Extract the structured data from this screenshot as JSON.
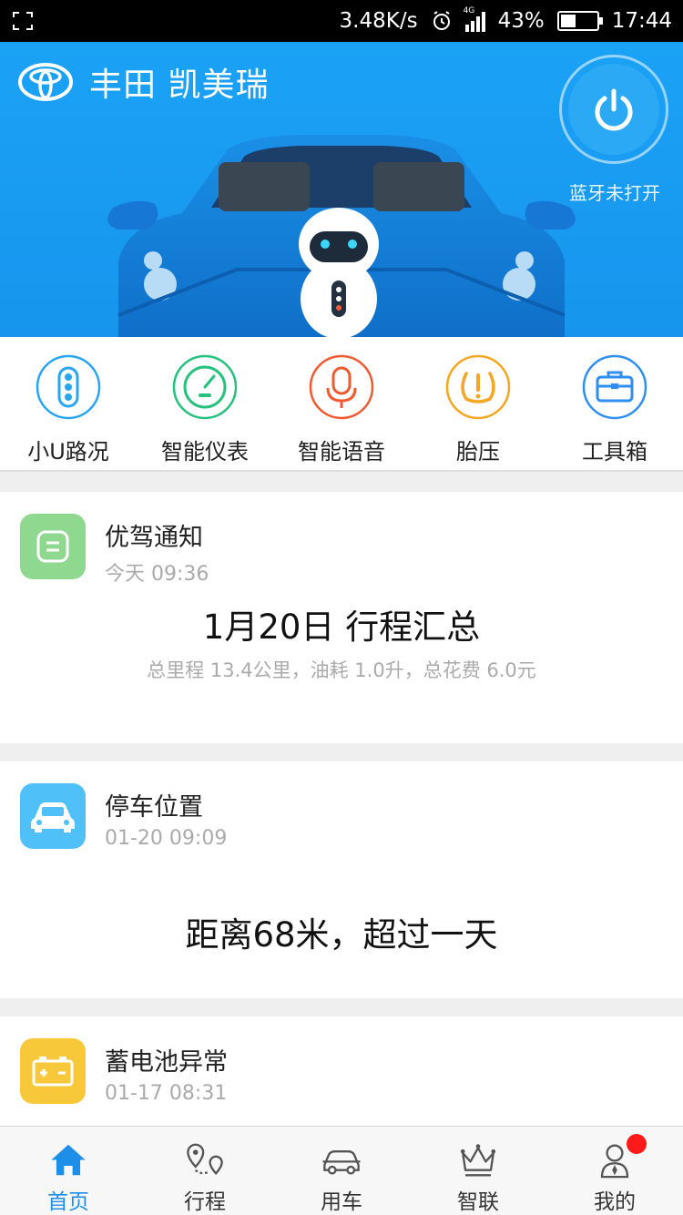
{
  "status_bar": {
    "network_speed": "3.48K/s",
    "signal": "4G",
    "battery": "43%",
    "battery_level": 0.43,
    "time": "17:44"
  },
  "header": {
    "title": "丰田 凯美瑞",
    "bluetooth_status": "蓝牙未打开"
  },
  "quick_nav": [
    {
      "label": "小U路况",
      "icon": "traffic-light-icon",
      "color": "#2aa5ef"
    },
    {
      "label": "智能仪表",
      "icon": "speedometer-icon",
      "color": "#25c17d"
    },
    {
      "label": "智能语音",
      "icon": "microphone-icon",
      "color": "#ef5a2f"
    },
    {
      "label": "胎压",
      "icon": "tire-pressure-icon",
      "color": "#f5a623"
    },
    {
      "label": "工具箱",
      "icon": "toolbox-icon",
      "color": "#2f8ff0"
    }
  ],
  "cards": [
    {
      "title": "优驾通知",
      "time": "今天 09:36",
      "headline": "1月20日 行程汇总",
      "detail": "总里程 13.4公里，油耗 1.0升，总花费 6.0元",
      "icon": "notice-icon",
      "color": "#8fd88f"
    },
    {
      "title": "停车位置",
      "time": "01-20 09:09",
      "headline": "距离68米，超过一天",
      "icon": "car-icon",
      "color": "#4fc1f8"
    },
    {
      "title": "蓄电池异常",
      "time": "01-17 08:31",
      "icon": "battery-icon",
      "color": "#f7c93a"
    }
  ],
  "tabs": [
    {
      "label": "首页",
      "icon": "home-icon",
      "active": true
    },
    {
      "label": "行程",
      "icon": "route-icon",
      "active": false
    },
    {
      "label": "用车",
      "icon": "car-outline-icon",
      "active": false
    },
    {
      "label": "智联",
      "icon": "crown-icon",
      "active": false
    },
    {
      "label": "我的",
      "icon": "user-icon",
      "active": false
    }
  ],
  "colors": {
    "accent": "#1e8fe8",
    "hero_blue": "#1aa2f5",
    "badge": "#ff1a1a"
  }
}
